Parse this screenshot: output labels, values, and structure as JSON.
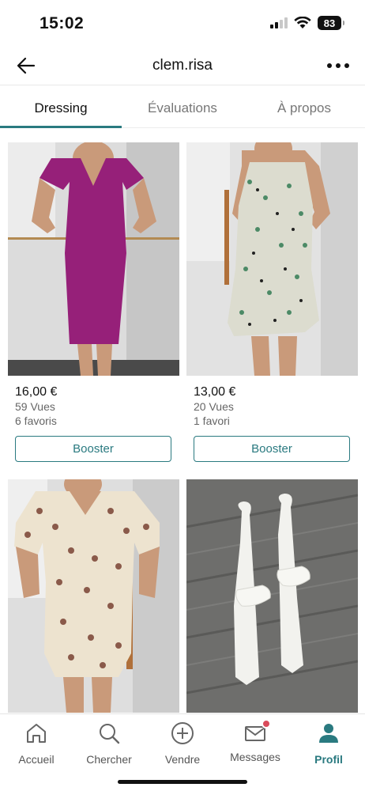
{
  "status": {
    "time": "15:02",
    "battery": "83"
  },
  "header": {
    "title": "clem.risa"
  },
  "tabs": [
    {
      "label": "Dressing",
      "active": true
    },
    {
      "label": "Évaluations",
      "active": false
    },
    {
      "label": "À propos",
      "active": false
    }
  ],
  "items": [
    {
      "price": "16,00 €",
      "views": "59 Vues",
      "favs": "6 favoris",
      "button": "Booster"
    },
    {
      "price": "13,00 €",
      "views": "20 Vues",
      "favs": "1 favori",
      "button": "Booster"
    },
    {
      "price": "",
      "views": "",
      "favs": "",
      "button": ""
    },
    {
      "price": "",
      "views": "",
      "favs": "",
      "button": ""
    }
  ],
  "nav": [
    {
      "label": "Accueil",
      "icon": "home-icon"
    },
    {
      "label": "Chercher",
      "icon": "search-icon"
    },
    {
      "label": "Vendre",
      "icon": "plus-circle-icon"
    },
    {
      "label": "Messages",
      "icon": "mail-icon"
    },
    {
      "label": "Profil",
      "icon": "person-icon"
    }
  ],
  "colors": {
    "accent": "#2a7a80",
    "badge": "#d94b5b"
  }
}
